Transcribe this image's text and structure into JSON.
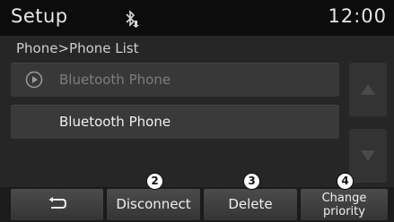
{
  "header": {
    "title": "Setup",
    "time": "12:00",
    "status_icon": "bluetooth-icon"
  },
  "breadcrumb": "Phone>Phone List",
  "phone_list": [
    {
      "label": "Bluetooth Phone",
      "state": "disabled",
      "icon": "play-circle-icon"
    },
    {
      "label": "Bluetooth Phone",
      "state": "normal"
    }
  ],
  "scroll": {
    "up_icon": "triangle-up-icon",
    "down_icon": "triangle-down-icon"
  },
  "toolbar": {
    "back_icon": "back-arrow-icon",
    "disconnect_label": "Disconnect",
    "delete_label": "Delete",
    "change_priority_line1": "Change",
    "change_priority_line2": "priority"
  },
  "callouts": {
    "disconnect": "2",
    "delete": "3",
    "change_priority": "4"
  },
  "colors": {
    "background": "#262626",
    "header": "#0c0c0c",
    "text": "#f0f0f0",
    "disabled_text": "#7d7d7d"
  }
}
